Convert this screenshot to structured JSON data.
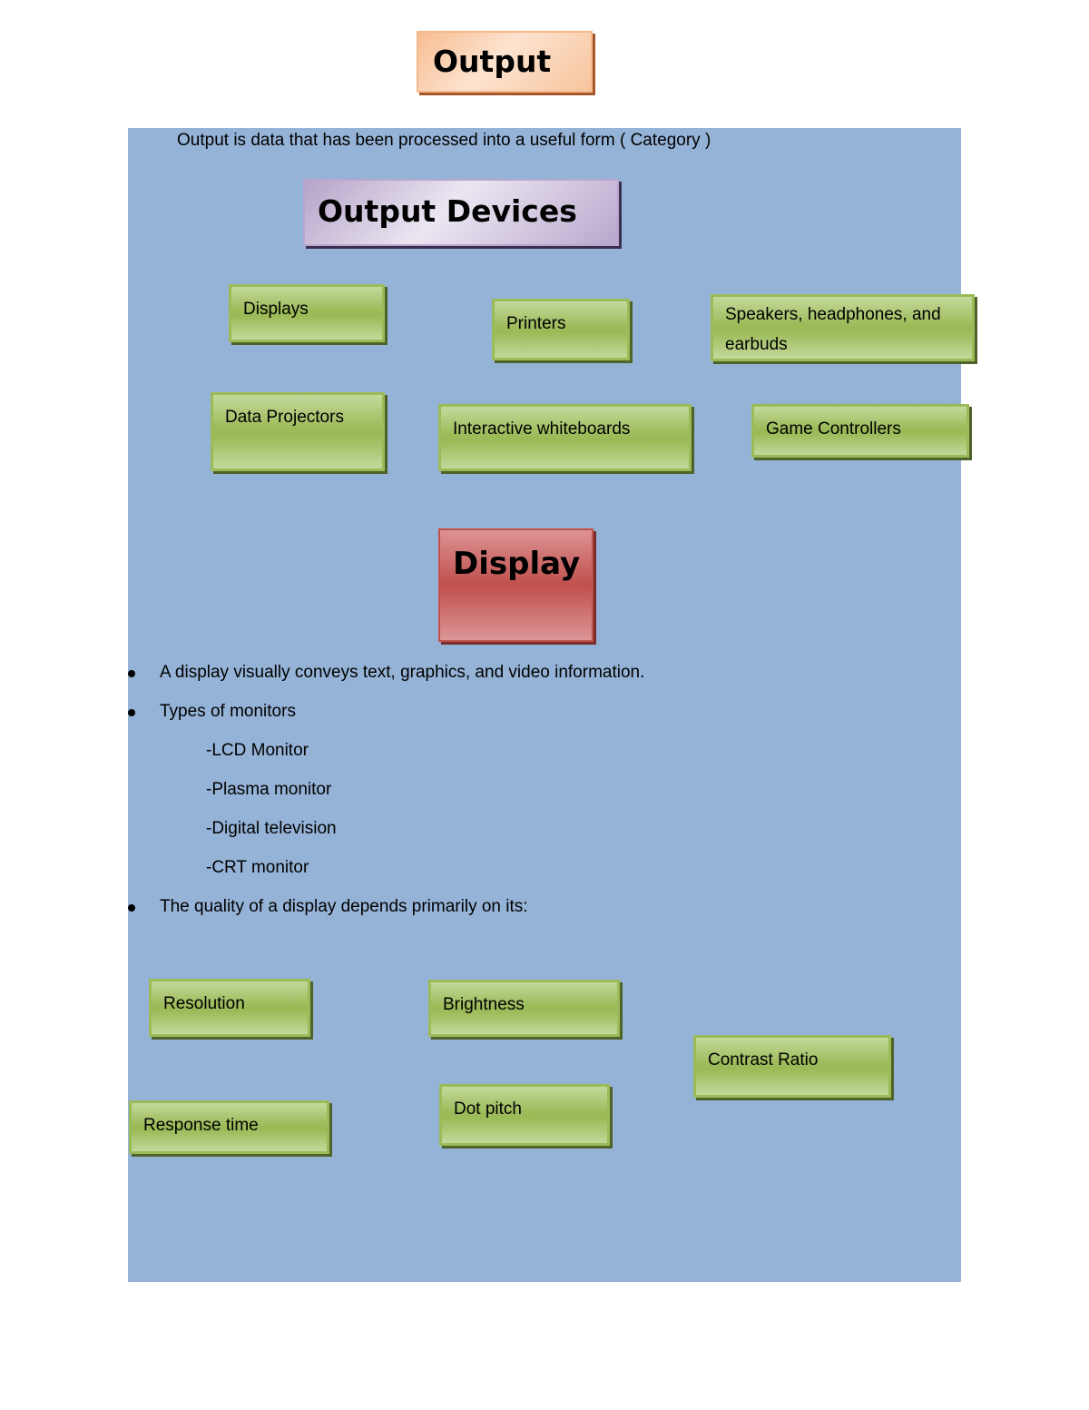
{
  "title": "Output",
  "intro": "Output is data that has been processed into a useful form ( Category )",
  "section_output_devices": {
    "heading": "Output Devices",
    "items": [
      "Displays",
      "Printers",
      "Speakers, headphones, and earbuds",
      "Data Projectors",
      "Interactive whiteboards",
      "Game Controllers"
    ]
  },
  "section_display": {
    "heading": "Display",
    "bullets": [
      "A display visually conveys text, graphics, and video information.",
      "Types of monitors",
      "The quality of a display depends primarily on its:"
    ],
    "monitor_types": [
      "-LCD Monitor",
      "-Plasma monitor",
      "-Digital television",
      "-CRT monitor"
    ],
    "quality_factors": [
      "Resolution",
      "Brightness",
      "Contrast Ratio",
      "Response time",
      "Dot pitch"
    ]
  },
  "colors": {
    "panel": "#95b3d7",
    "title_box": "#fbd4b4",
    "section_box": "#ccc0da",
    "item_box": "#9bbb59",
    "display_box": "#c0504d"
  }
}
